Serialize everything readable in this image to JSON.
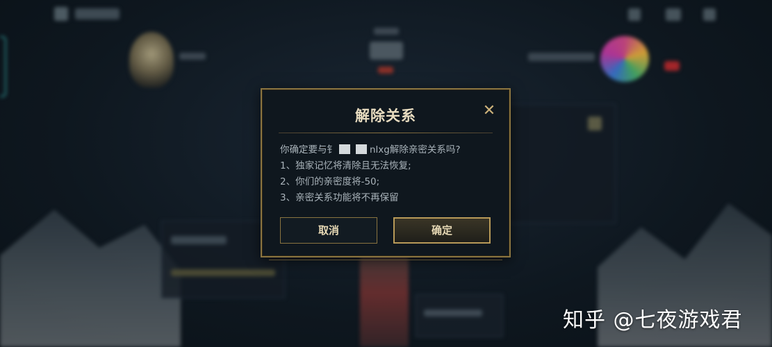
{
  "dialog": {
    "title": "解除关系",
    "close_icon": "✕",
    "message": {
      "prefix": "你确定要与",
      "name_start": "钅",
      "name_end": "nlxg",
      "suffix": "解除亲密关系吗?"
    },
    "items": [
      "1、独家记忆将清除且无法恢复;",
      "2、你们的亲密度将-50;",
      "3、亲密关系功能将不再保留"
    ],
    "cancel_label": "取消",
    "confirm_label": "确定"
  },
  "watermark": "知乎 @七夜游戏君",
  "colors": {
    "accent_gold": "#8a7440",
    "text_gold": "#e6d8b4",
    "body_text": "#a9b3ba",
    "dialog_bg": "#0f171e"
  }
}
